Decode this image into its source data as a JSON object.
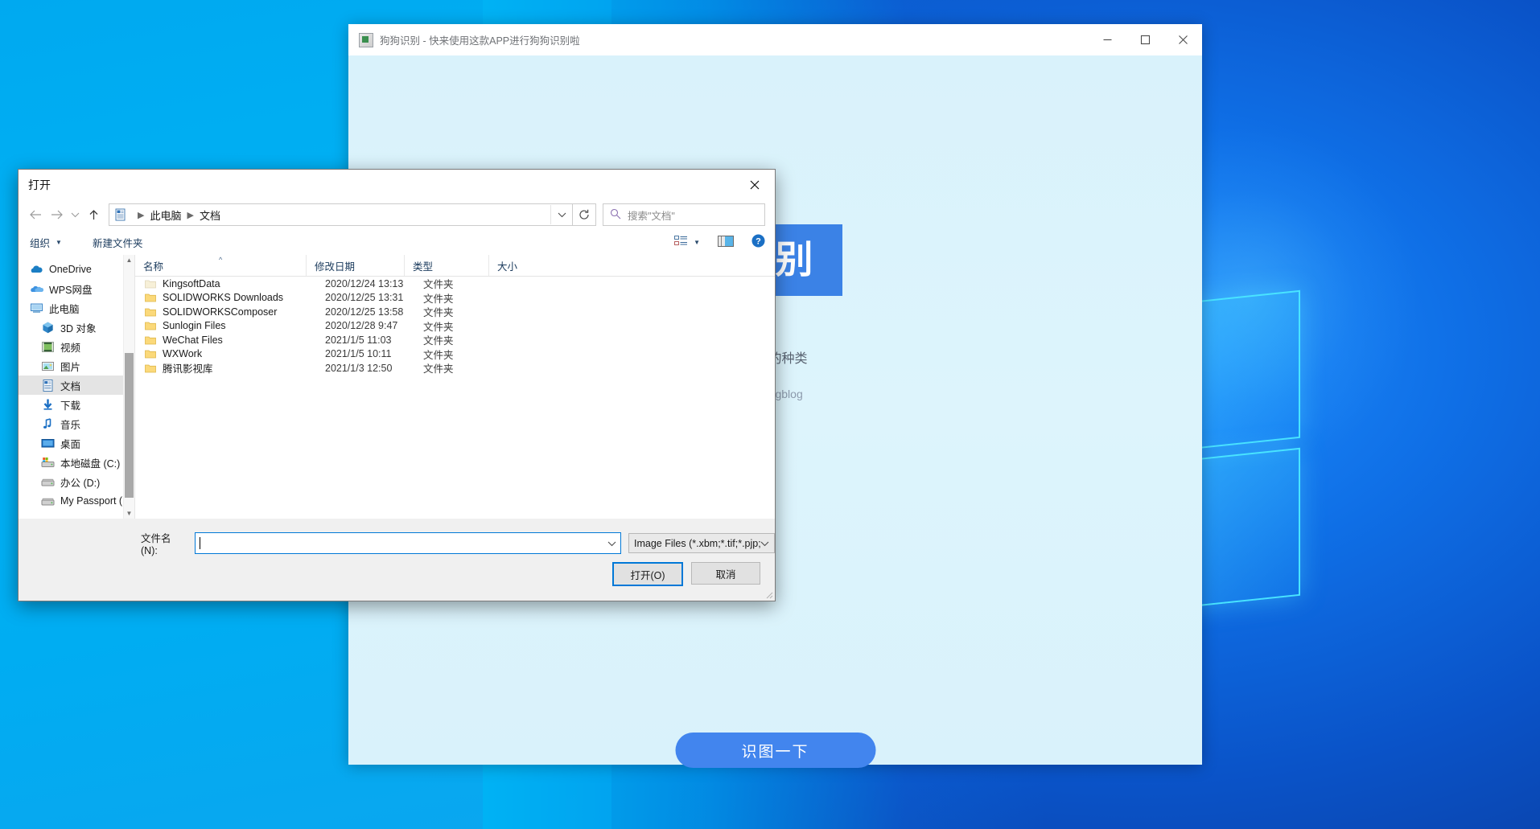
{
  "desktop": {
    "wallpaper_name": "windows-10-hero-wallpaper"
  },
  "app_window": {
    "title": "狗狗识别 - 快来使用这款APP进行狗狗识别啦",
    "title_icon": "app-window-icon",
    "window_controls": {
      "minimize": "minimize-icon",
      "maximize": "maximize-icon",
      "close": "close-icon"
    },
    "heading": "识别",
    "subtitle": "狗狗的种类",
    "credit": "eigangblog",
    "action_button": "识图一下",
    "accent_color": "#4285ee",
    "heading_bg": "#3b82e6",
    "body_bg": "#ddf3fb"
  },
  "dialog": {
    "title": "打开",
    "close_icon": "close-icon",
    "nav": {
      "back": "back-arrow-icon",
      "forward": "forward-arrow-icon",
      "recent": "chevron-down-icon",
      "up": "up-arrow-icon"
    },
    "address": {
      "icon": "documents-folder-icon",
      "crumbs": [
        "此电脑",
        "文档"
      ],
      "dropdown_icon": "chevron-down-icon",
      "refresh_icon": "refresh-icon"
    },
    "search": {
      "icon": "search-icon",
      "placeholder": "搜索\"文档\""
    },
    "commandbar": {
      "organize": "组织",
      "organize_caret": "▼",
      "new_folder": "新建文件夹",
      "view_icon": "view-layout-icon",
      "view_caret": "chevron-down-icon",
      "preview_icon": "preview-pane-icon",
      "help_icon": "help-icon"
    },
    "nav_pane": {
      "items": [
        {
          "label": "OneDrive",
          "icon": "onedrive-cloud-icon",
          "indent": false,
          "selected": false
        },
        {
          "label": "WPS网盘",
          "icon": "wps-cloud-icon",
          "indent": false,
          "selected": false
        },
        {
          "label": "此电脑",
          "icon": "this-pc-icon",
          "indent": false,
          "selected": false
        },
        {
          "label": "3D 对象",
          "icon": "3d-objects-icon",
          "indent": true,
          "selected": false
        },
        {
          "label": "视频",
          "icon": "videos-icon",
          "indent": true,
          "selected": false
        },
        {
          "label": "图片",
          "icon": "pictures-icon",
          "indent": true,
          "selected": false
        },
        {
          "label": "文档",
          "icon": "documents-icon",
          "indent": true,
          "selected": true
        },
        {
          "label": "下载",
          "icon": "downloads-icon",
          "indent": true,
          "selected": false
        },
        {
          "label": "音乐",
          "icon": "music-icon",
          "indent": true,
          "selected": false
        },
        {
          "label": "桌面",
          "icon": "desktop-icon",
          "indent": true,
          "selected": false
        },
        {
          "label": "本地磁盘 (C:)",
          "icon": "local-disk-icon",
          "indent": true,
          "selected": false
        },
        {
          "label": "办公 (D:)",
          "icon": "drive-icon",
          "indent": true,
          "selected": false
        },
        {
          "label": "My Passport (E",
          "icon": "external-drive-icon",
          "indent": true,
          "selected": false
        }
      ],
      "scroll_up_icon": "scroll-up-arrow-icon",
      "scroll_down_icon": "scroll-down-arrow-icon"
    },
    "file_list": {
      "columns": [
        "名称",
        "修改日期",
        "类型",
        "大小"
      ],
      "sort_indicator": "^",
      "rows": [
        {
          "name": "KingsoftData",
          "date": "2020/12/24 13:13",
          "type": "文件夹",
          "size": ""
        },
        {
          "name": "SOLIDWORKS Downloads",
          "date": "2020/12/25 13:31",
          "type": "文件夹",
          "size": ""
        },
        {
          "name": "SOLIDWORKSComposer",
          "date": "2020/12/25 13:58",
          "type": "文件夹",
          "size": ""
        },
        {
          "name": "Sunlogin Files",
          "date": "2020/12/28 9:47",
          "type": "文件夹",
          "size": ""
        },
        {
          "name": "WeChat Files",
          "date": "2021/1/5 11:03",
          "type": "文件夹",
          "size": ""
        },
        {
          "name": "WXWork",
          "date": "2021/1/5 10:11",
          "type": "文件夹",
          "size": ""
        },
        {
          "name": "腾讯影视库",
          "date": "2021/1/3 12:50",
          "type": "文件夹",
          "size": ""
        }
      ]
    },
    "bottom": {
      "filename_label": "文件名(N):",
      "filename_value": "",
      "filename_dropdown_icon": "chevron-down-icon",
      "filter_value": "Image Files (*.xbm;*.tif;*.pjp;",
      "filter_caret_icon": "chevron-down-icon",
      "open_button": "打开(O)",
      "cancel_button": "取消"
    }
  }
}
